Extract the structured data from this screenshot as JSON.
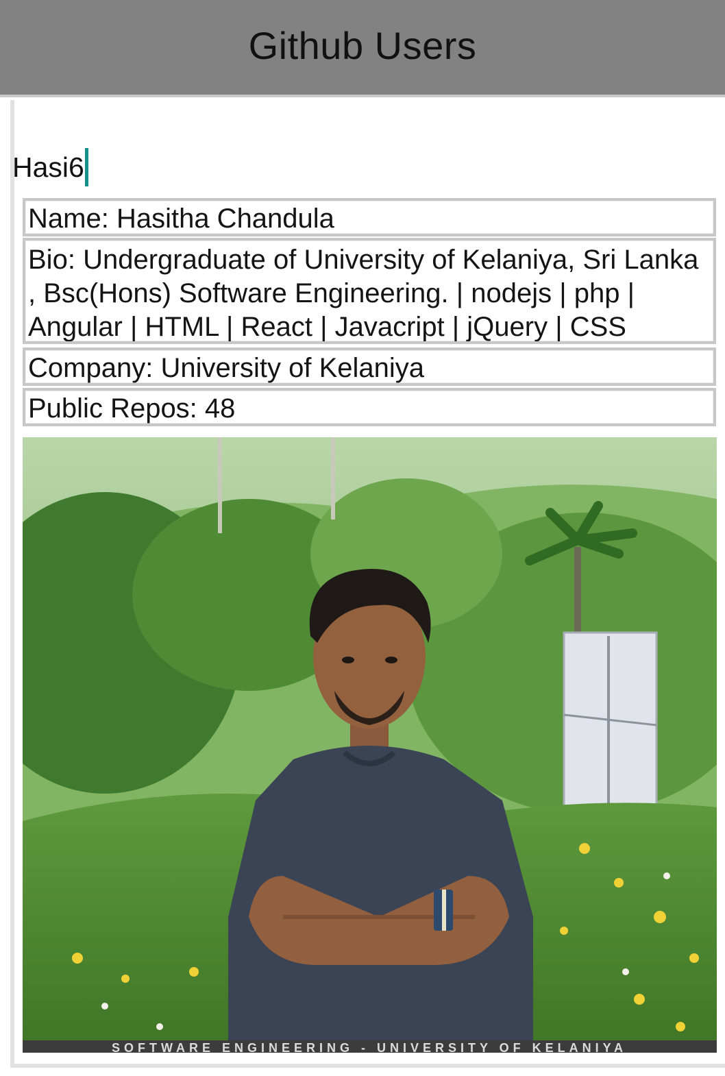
{
  "header": {
    "title": "Github Users"
  },
  "search": {
    "value": "Hasi6"
  },
  "profile": {
    "name_label": "Name:",
    "name": "Hasitha Chandula",
    "bio_label": "Bio:",
    "bio": "Undergraduate of University of Kelaniya, Sri Lanka , Bsc(Hons) Software Engineering. |  nodejs | php | Angular | HTML | React | Javacript | jQuery | CSS",
    "company_label": "Company:",
    "company": "University of Kelaniya",
    "repos_label": "Public Repos:",
    "public_repos": "48",
    "avatar_banner": "SOFTWARE ENGINEERING - UNIVERSITY OF KELANIYA"
  },
  "colors": {
    "header_bg": "#828282",
    "caret": "#139089",
    "box_border": "#c7c7c7"
  }
}
